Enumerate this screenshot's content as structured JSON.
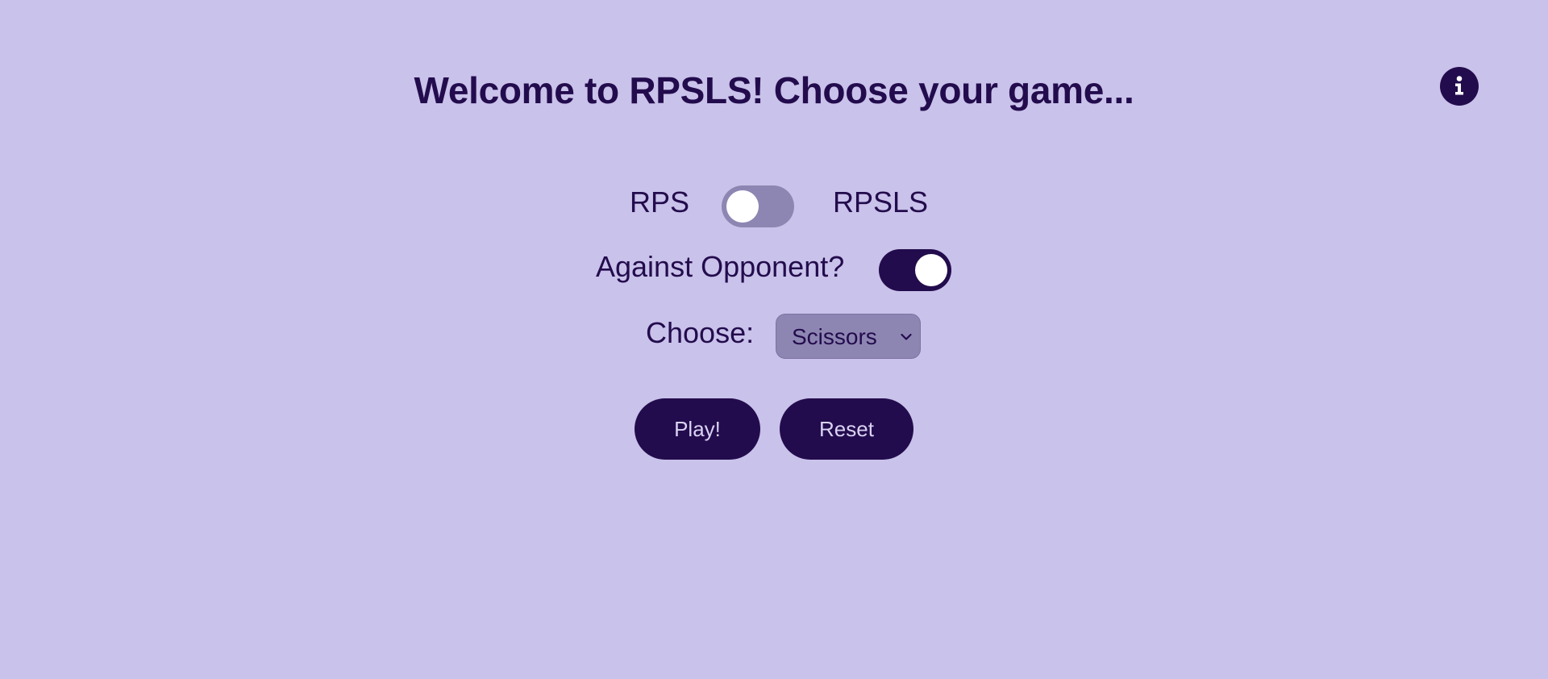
{
  "header": {
    "title": "Welcome to RPSLS! Choose your game...",
    "info_icon": "info-icon"
  },
  "game_mode": {
    "left_label": "RPS",
    "right_label": "RPSLS",
    "is_rpsls": false
  },
  "opponent": {
    "label": "Against Opponent?",
    "enabled": true
  },
  "choice": {
    "label": "Choose:",
    "selected": "Scissors",
    "dropdown_icon": "chevron-down-icon"
  },
  "actions": {
    "play_label": "Play!",
    "reset_label": "Reset"
  },
  "colors": {
    "background": "#c9c2ea",
    "primary": "#230c4d",
    "toggle_off_track": "#8e86b2",
    "select_background": "#8e86b2",
    "button_text": "#d9d3f3"
  }
}
